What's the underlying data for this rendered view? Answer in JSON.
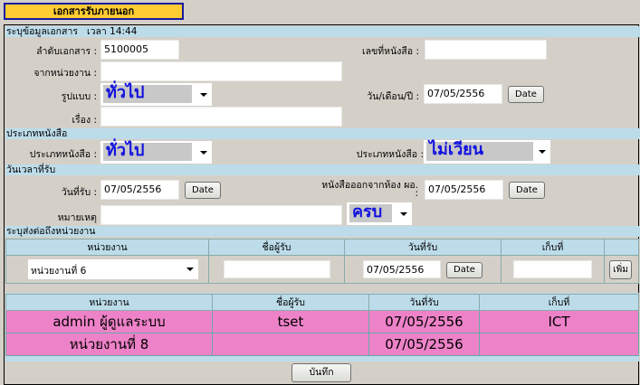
{
  "title": "เอกสารรับภายนอก",
  "sections": {
    "doc_info": "ระบุข้อมูลเอกสาร",
    "time_label": "เวลา 14:44",
    "doc_type": "ประเภทหนังสือ",
    "receive_time": "วันเวลาที่รับ",
    "forward": "ระบุส่งต่อถึงหน่วยงาน"
  },
  "form": {
    "doc_no_label": "ลำดับเอกสาร :",
    "doc_no": "5100005",
    "letter_no_label": "เลขที่หนังสือ :",
    "letter_no": "",
    "from_label": "จากหน่วยงาน :",
    "from": "",
    "format_label": "รูปแบบ :",
    "format": "ทั่วไป",
    "date_label": "วัน/เดือน/ปี :",
    "date": "07/05/2556",
    "subject_label": "เรื่อง :",
    "subject": "",
    "type1_label": "ประเภทหนังสือ :",
    "type1": "ทั่วไป",
    "type2_label": "ประเภทหนังสือ :",
    "type2": "ไม่เวียน",
    "recv_date_label": "วันที่รับ :",
    "recv_date": "07/05/2556",
    "out_label": "หนังสือออกจากห้อง ผอ.",
    "out_colon": ":",
    "out_date": "07/05/2556",
    "note_label": "หมายเหตุ",
    "note": "",
    "status": "ครบ",
    "date_btn": "Date"
  },
  "forward_table": {
    "headers": [
      "หน่วยงาน",
      "ชื่อผู้รับ",
      "วันที่รับ",
      "เก็บที่"
    ],
    "unit": "หน่วยงานที่ 6",
    "receiver": "",
    "date": "07/05/2556",
    "store": "",
    "add_btn": "เพิ่ม"
  },
  "result_table": {
    "headers": [
      "หน่วยงาน",
      "ชื่อผู้รับ",
      "วันที่รับ",
      "เก็บที่"
    ],
    "rows": [
      [
        "admin ผู้ดูแลระบบ",
        "tset",
        "07/05/2556",
        "ICT"
      ],
      [
        "หน่วยงานที่ 8",
        "",
        "07/05/2556",
        ""
      ]
    ]
  },
  "save_btn": "บันทึก"
}
